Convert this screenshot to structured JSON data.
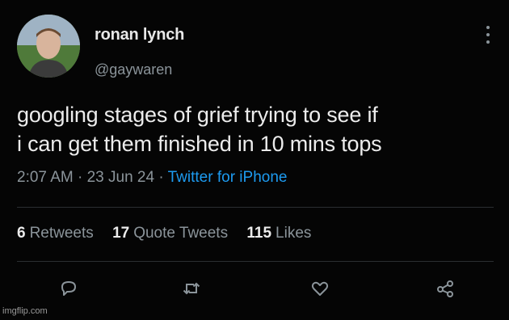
{
  "author": {
    "display_name": "ronan lynch",
    "handle": "@gaywaren"
  },
  "tweet": {
    "text_line1": "googling stages of grief trying to see if",
    "text_line2": "i can get them finished in 10 mins tops",
    "time": "2:07 AM",
    "date": "23 Jun 24",
    "source": "Twitter for iPhone",
    "separator": "·"
  },
  "stats": {
    "retweets_count": "6",
    "retweets_label": "Retweets",
    "quotes_count": "17",
    "quotes_label": "Quote Tweets",
    "likes_count": "115",
    "likes_label": "Likes"
  },
  "actions": {
    "reply_icon": "reply-icon",
    "retweet_icon": "retweet-icon",
    "like_icon": "heart-icon",
    "share_icon": "share-icon"
  },
  "watermark": "imgflip.com",
  "colors": {
    "background": "#050505",
    "text": "#ececec",
    "secondary": "#8b949a",
    "link": "#1d9bf0"
  }
}
